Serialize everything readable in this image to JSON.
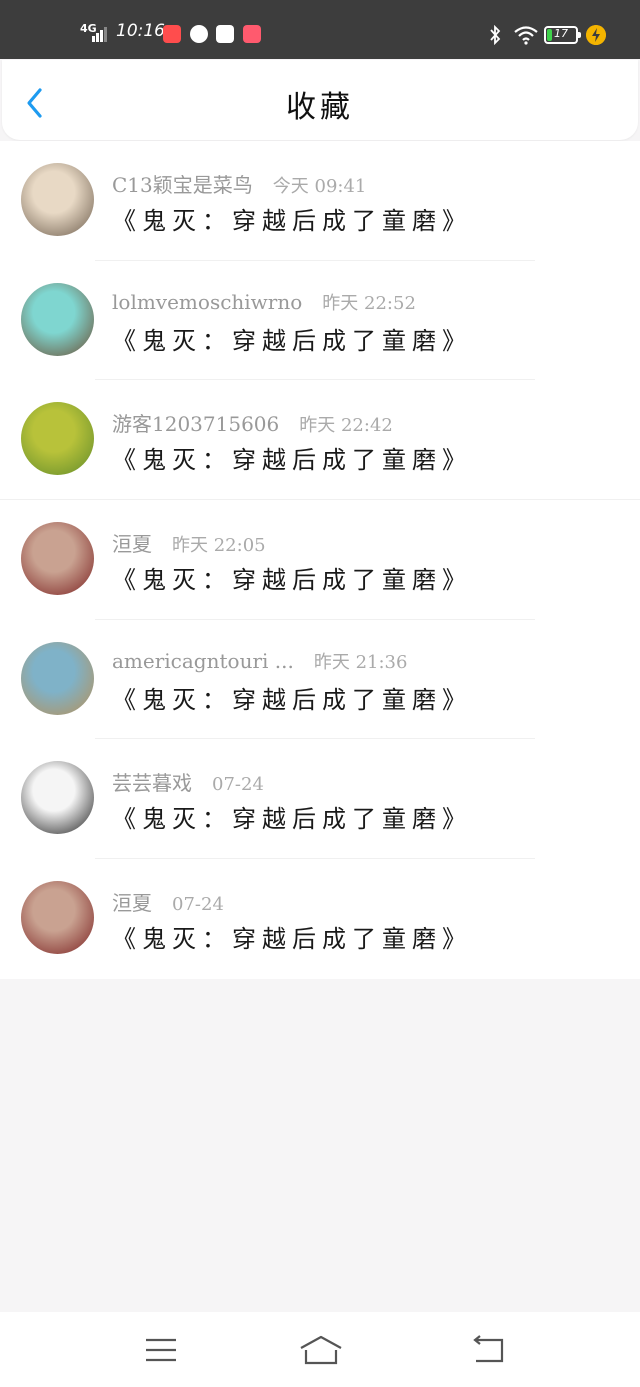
{
  "status_bar": {
    "network": "4G",
    "time": "10:16",
    "battery_text": "17",
    "battery_level": 0.17,
    "app_colors": [
      "#ff4d4d",
      "#ffffff",
      "#ffffff",
      "#ff5a6e"
    ],
    "icons": [
      "signal-icon",
      "bluetooth-icon",
      "wifi-icon",
      "battery-icon",
      "charging-icon"
    ]
  },
  "header": {
    "title": "收藏",
    "back_icon": "chevron-left-icon",
    "accent_color": "#1e9bf0"
  },
  "items": [
    {
      "user": "C13颖宝是菜鸟",
      "time": "今天 09:41",
      "title": "《鬼灭：穿越后成了童磨》",
      "avatar_colors": [
        "#e8d9c5",
        "#6a5a4a"
      ]
    },
    {
      "user": "lolmvemoschiwrno",
      "time": "昨天 22:52",
      "title": "《鬼灭：穿越后成了童磨》",
      "avatar_colors": [
        "#7fd6d0",
        "#6b4a2e"
      ]
    },
    {
      "user": "游客1203715606",
      "time": "昨天 22:42",
      "title": "《鬼灭：穿越后成了童磨》",
      "avatar_colors": [
        "#b8c23a",
        "#5f8a2a"
      ]
    },
    {
      "user": "洹夏",
      "time": "昨天 22:05",
      "title": "《鬼灭：穿越后成了童磨》",
      "avatar_colors": [
        "#c9a291",
        "#7a1f1f"
      ]
    },
    {
      "user": "americagntouri ...",
      "time": "昨天 21:36",
      "title": "《鬼灭：穿越后成了童磨》",
      "avatar_colors": [
        "#7fb2c8",
        "#b88f55"
      ]
    },
    {
      "user": "芸芸暮戏",
      "time": "07-24",
      "title": "《鬼灭：穿越后成了童磨》",
      "avatar_colors": [
        "#f5f5f5",
        "#1a1a1a"
      ]
    },
    {
      "user": "洹夏",
      "time": "07-24",
      "title": "《鬼灭：穿越后成了童磨》",
      "avatar_colors": [
        "#c9a291",
        "#7a1f1f"
      ]
    }
  ],
  "nav": {
    "icons": [
      "menu-icon",
      "home-icon",
      "back-icon"
    ]
  }
}
